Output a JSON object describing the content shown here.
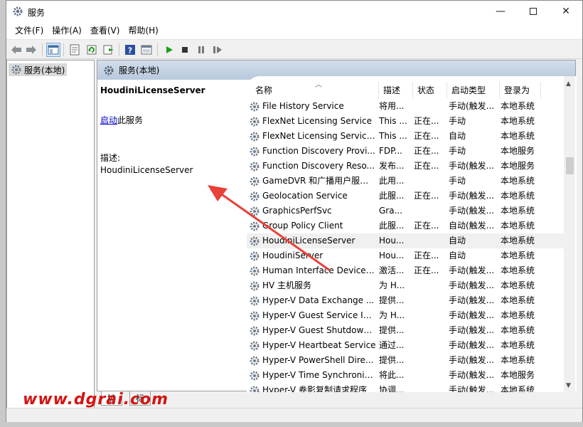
{
  "window": {
    "title": "服务"
  },
  "menu": [
    "文件(F)",
    "操作(A)",
    "查看(V)",
    "帮助(H)"
  ],
  "tree": {
    "root": "服务(本地)"
  },
  "panel": {
    "header": "服务(本地)"
  },
  "detail": {
    "service_name": "HoudiniLicenseServer",
    "start_link": "启动",
    "start_suffix": "此服务",
    "desc_label": "描述:",
    "desc_value": "HoudiniLicenseServer"
  },
  "columns": {
    "name": "名称",
    "desc": "描述",
    "state": "状态",
    "startup": "启动类型",
    "logon": "登录为"
  },
  "rows": [
    {
      "name": "File History Service",
      "desc": "将用...",
      "state": "",
      "startup": "手动(触发...",
      "logon": "本地系统"
    },
    {
      "name": "FlexNet Licensing Service",
      "desc": "This ...",
      "state": "正在...",
      "startup": "手动",
      "logon": "本地系统"
    },
    {
      "name": "FlexNet Licensing Service...",
      "desc": "This ...",
      "state": "正在...",
      "startup": "自动",
      "logon": "本地系统"
    },
    {
      "name": "Function Discovery Provi...",
      "desc": "FDP...",
      "state": "正在...",
      "startup": "手动",
      "logon": "本地服务"
    },
    {
      "name": "Function Discovery Reso...",
      "desc": "发布...",
      "state": "正在...",
      "startup": "手动(触发...",
      "logon": "本地服务"
    },
    {
      "name": "GameDVR 和广播用户服务...",
      "desc": "此用...",
      "state": "",
      "startup": "手动",
      "logon": "本地系统"
    },
    {
      "name": "Geolocation Service",
      "desc": "此服...",
      "state": "正在...",
      "startup": "手动(触发...",
      "logon": "本地系统"
    },
    {
      "name": "GraphicsPerfSvc",
      "desc": "Gra...",
      "state": "",
      "startup": "手动(触发...",
      "logon": "本地系统"
    },
    {
      "name": "Group Policy Client",
      "desc": "此服...",
      "state": "正在...",
      "startup": "自动(触发...",
      "logon": "本地系统"
    },
    {
      "name": "HoudiniLicenseServer",
      "desc": "Hou...",
      "state": "",
      "startup": "自动",
      "logon": "本地系统"
    },
    {
      "name": "HoudiniServer",
      "desc": "Hou...",
      "state": "正在...",
      "startup": "自动",
      "logon": "本地系统"
    },
    {
      "name": "Human Interface Device ...",
      "desc": "激活...",
      "state": "正在...",
      "startup": "手动(触发...",
      "logon": "本地系统"
    },
    {
      "name": "HV 主机服务",
      "desc": "为 H...",
      "state": "",
      "startup": "手动(触发...",
      "logon": "本地系统"
    },
    {
      "name": "Hyper-V Data Exchange ...",
      "desc": "提供...",
      "state": "",
      "startup": "手动(触发...",
      "logon": "本地系统"
    },
    {
      "name": "Hyper-V Guest Service In...",
      "desc": "为 H...",
      "state": "",
      "startup": "手动(触发...",
      "logon": "本地系统"
    },
    {
      "name": "Hyper-V Guest Shutdown ...",
      "desc": "提供...",
      "state": "",
      "startup": "手动(触发...",
      "logon": "本地系统"
    },
    {
      "name": "Hyper-V Heartbeat Service",
      "desc": "通过...",
      "state": "",
      "startup": "手动(触发...",
      "logon": "本地系统"
    },
    {
      "name": "Hyper-V PowerShell Dire...",
      "desc": "提供...",
      "state": "",
      "startup": "手动(触发...",
      "logon": "本地系统"
    },
    {
      "name": "Hyper-V Time Synchroniz...",
      "desc": "将此...",
      "state": "",
      "startup": "手动(触发...",
      "logon": "本地服务"
    },
    {
      "name": "Hyper-V 卷影复制请求程序",
      "desc": "协调...",
      "state": "",
      "startup": "手动(触发...",
      "logon": "本地系统"
    }
  ],
  "selected_row": "HoudiniLicenseServer",
  "tabs": [
    "扩展",
    "标准"
  ],
  "watermark": "www.dgrai.com",
  "colors": {
    "header_gradient_top": "#d2deeb",
    "link": "#0000cc",
    "arrow": "#e8413a",
    "watermark": "#d41414",
    "play": "#1aa01a"
  }
}
